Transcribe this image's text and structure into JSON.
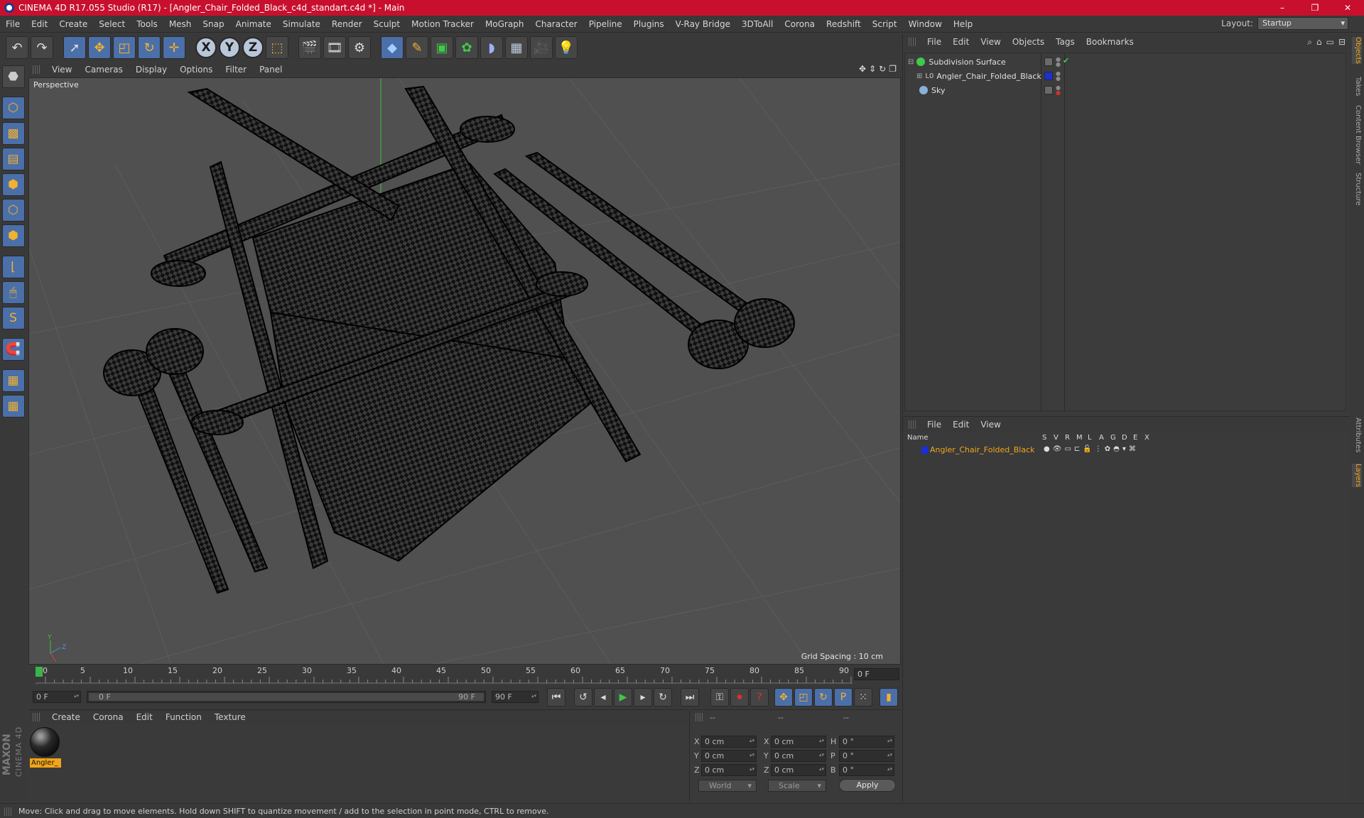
{
  "window": {
    "title": "CINEMA 4D R17.055 Studio (R17) - [Angler_Chair_Folded_Black_c4d_standart.c4d *] - Main",
    "controls": [
      "–",
      "❐",
      "✕"
    ]
  },
  "menubar": {
    "items": [
      "File",
      "Edit",
      "Create",
      "Select",
      "Tools",
      "Mesh",
      "Snap",
      "Animate",
      "Simulate",
      "Render",
      "Sculpt",
      "Motion Tracker",
      "MoGraph",
      "Character",
      "Pipeline",
      "Plugins",
      "V-Ray Bridge",
      "3DToAll",
      "Corona",
      "Redshift",
      "Script",
      "Window",
      "Help"
    ],
    "layout_label": "Layout:",
    "layout_value": "Startup"
  },
  "toolbar": {
    "axis_x": "X",
    "axis_y": "Y",
    "axis_z": "Z"
  },
  "viewport": {
    "menu": [
      "View",
      "Cameras",
      "Display",
      "Options",
      "Filter",
      "Panel"
    ],
    "label": "Perspective",
    "grid_spacing": "Grid Spacing : 10 cm"
  },
  "timeline": {
    "ticks": [
      "0",
      "5",
      "10",
      "15",
      "20",
      "25",
      "30",
      "35",
      "40",
      "45",
      "50",
      "55",
      "60",
      "65",
      "70",
      "75",
      "80",
      "85",
      "90"
    ],
    "current_frame": "0 F",
    "start_field": "0 F",
    "range_start": "0 F",
    "range_end": "90 F",
    "end_field": "90 F"
  },
  "material_panel": {
    "menu": [
      "Create",
      "Corona",
      "Edit",
      "Function",
      "Texture"
    ],
    "material_label": "Angler_"
  },
  "coords": {
    "headers": [
      "--",
      "--",
      "--"
    ],
    "rows": [
      {
        "a": "X",
        "av": "0 cm",
        "b": "X",
        "bv": "0 cm",
        "c": "H",
        "cv": "0 °"
      },
      {
        "a": "Y",
        "av": "0 cm",
        "b": "Y",
        "bv": "0 cm",
        "c": "P",
        "cv": "0 °"
      },
      {
        "a": "Z",
        "av": "0 cm",
        "b": "Z",
        "bv": "0 cm",
        "c": "B",
        "cv": "0 °"
      }
    ],
    "world": "World",
    "scale": "Scale",
    "apply": "Apply"
  },
  "status": "Move: Click and drag to move elements. Hold down SHIFT to quantize movement / add to the selection in point mode, CTRL to remove.",
  "branding": {
    "maxon": "MAXON",
    "product": "CINEMA 4D"
  },
  "objects_panel": {
    "menu": [
      "File",
      "Edit",
      "View",
      "Objects",
      "Tags",
      "Bookmarks"
    ],
    "items": [
      {
        "name": "Subdivision Surface",
        "color": "#3ecb4a"
      },
      {
        "name": "Angler_Chair_Folded_Black",
        "color": "#1a2fd6"
      },
      {
        "name": "Sky",
        "color": "#8ab0d8"
      }
    ]
  },
  "layers_panel": {
    "menu": [
      "File",
      "Edit",
      "View"
    ],
    "columns": [
      "Name",
      "S",
      "V",
      "R",
      "M",
      "L",
      "A",
      "G",
      "D",
      "E",
      "X"
    ],
    "layer_name": "Angler_Chair_Folded_Black"
  },
  "right_tabs": [
    "Objects",
    "Takes",
    "Content Browser",
    "Structure",
    "Attributes",
    "Layers"
  ]
}
